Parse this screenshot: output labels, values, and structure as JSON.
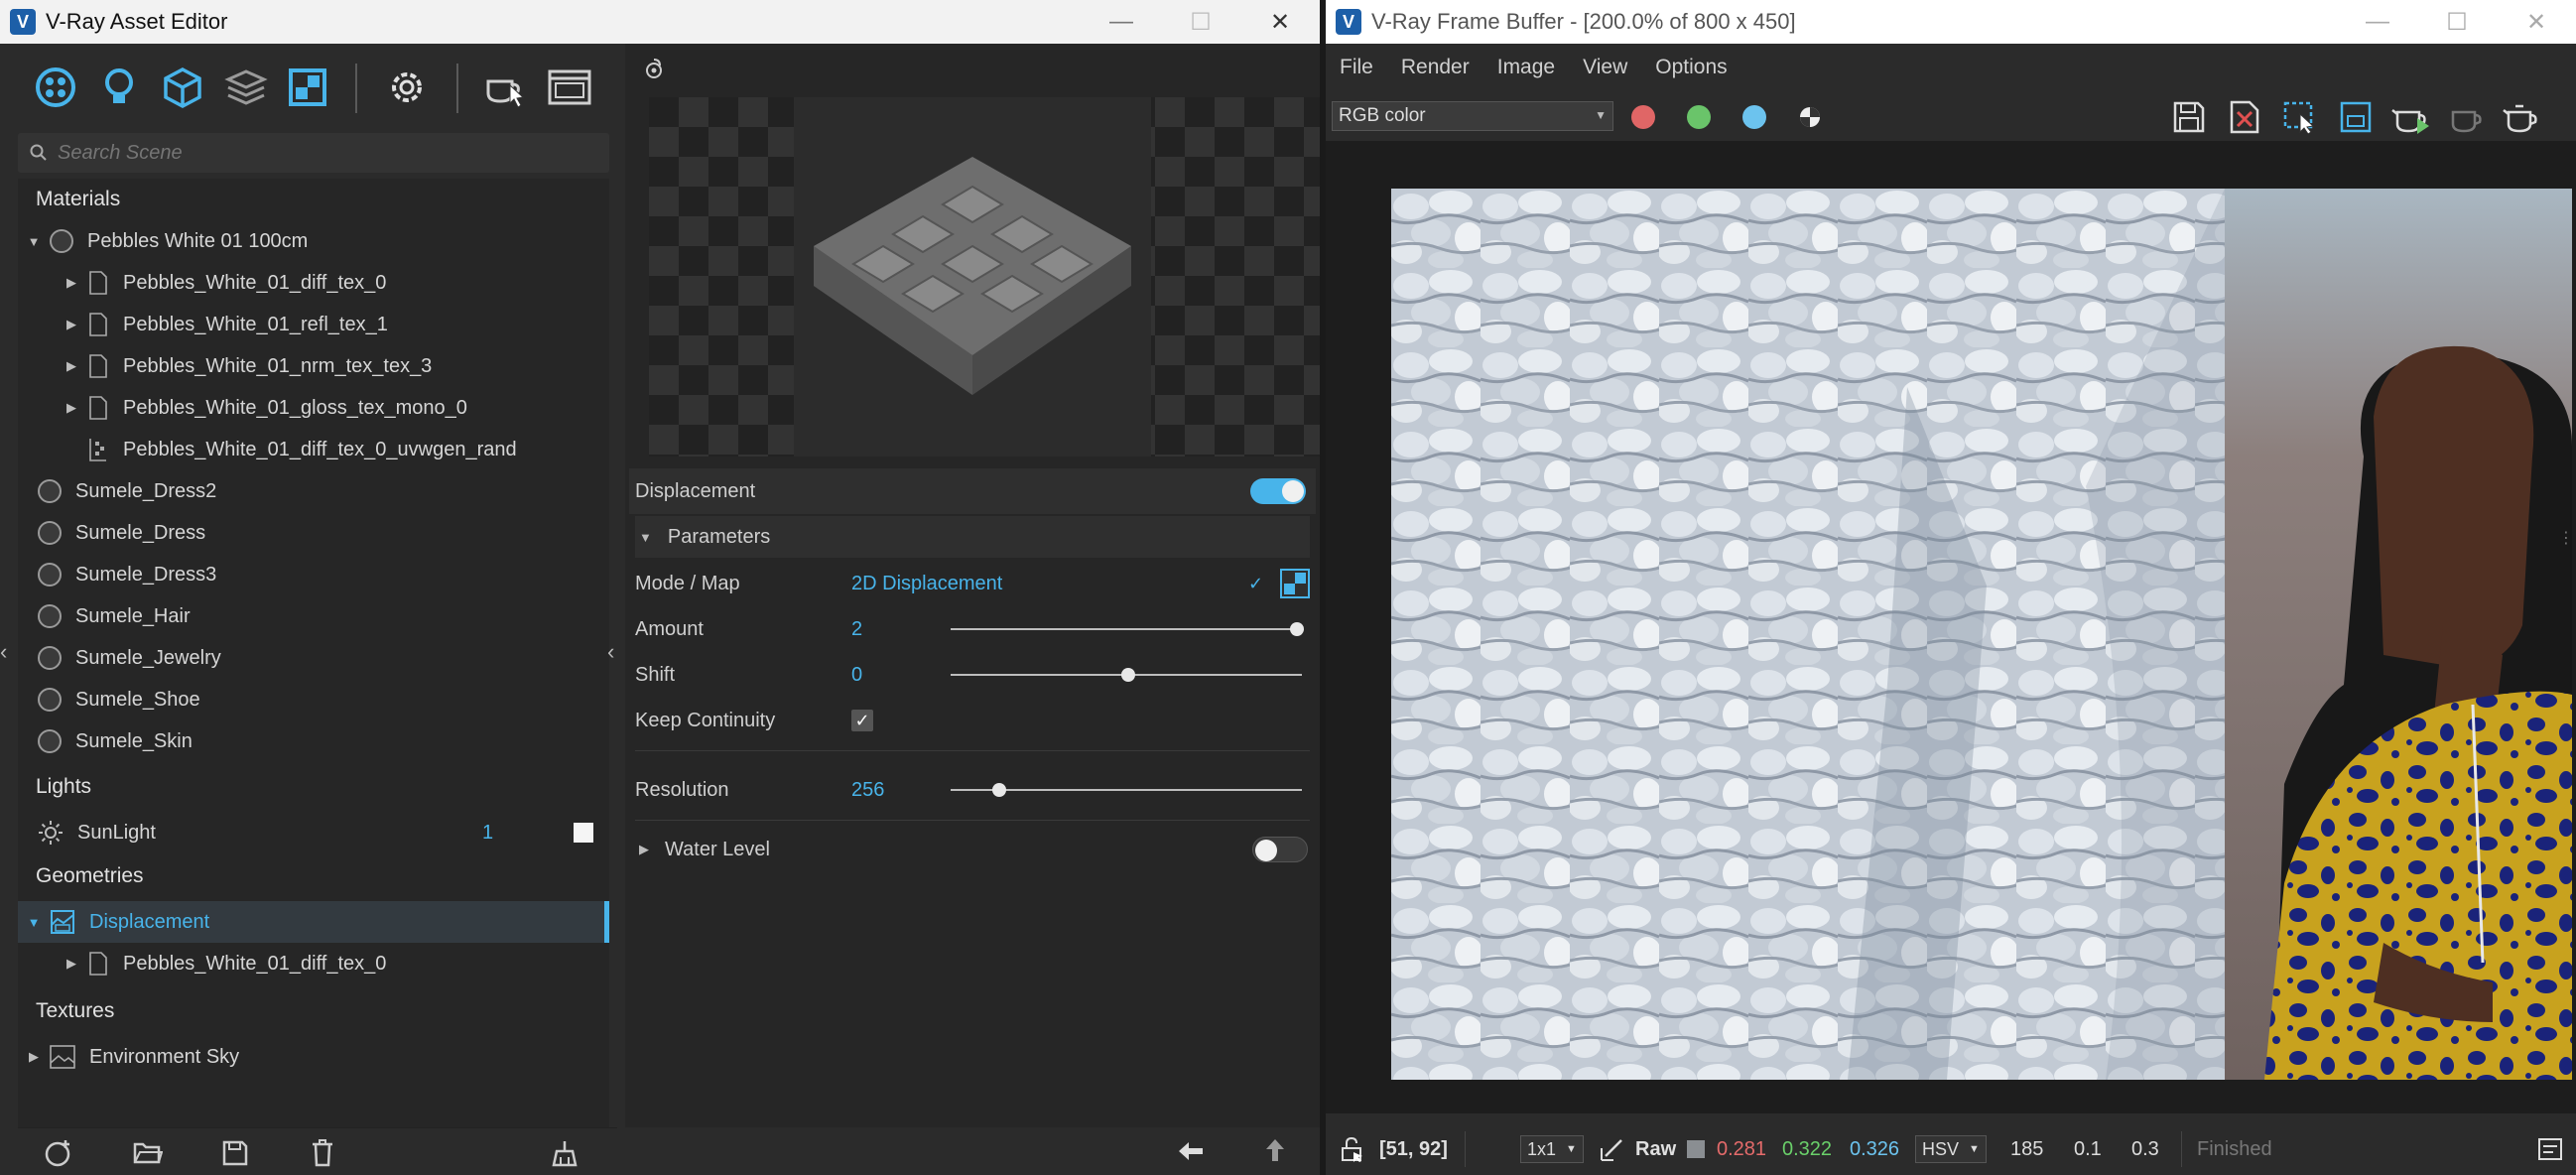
{
  "asset_editor": {
    "title": "V-Ray Asset Editor",
    "search_placeholder": "Search Scene",
    "sections": {
      "materials": "Materials",
      "lights": "Lights",
      "geometries": "Geometries",
      "textures": "Textures"
    },
    "material": {
      "name": "Pebbles White 01 100cm",
      "children": [
        "Pebbles_White_01_diff_tex_0",
        "Pebbles_White_01_refl_tex_1",
        "Pebbles_White_01_nrm_tex_tex_3",
        "Pebbles_White_01_gloss_tex_mono_0",
        "Pebbles_White_01_diff_tex_0_uvwgen_rand"
      ]
    },
    "materials_other": [
      "Sumele_Dress2",
      "Sumele_Dress",
      "Sumele_Dress3",
      "Sumele_Hair",
      "Sumele_Jewelry",
      "Sumele_Shoe",
      "Sumele_Skin"
    ],
    "light": {
      "name": "SunLight",
      "count": "1"
    },
    "geometry": {
      "name": "Displacement",
      "child": "Pebbles_White_01_diff_tex_0"
    },
    "texture": {
      "name": "Environment Sky"
    },
    "params": {
      "header": "Displacement",
      "group": "Parameters",
      "mode_label": "Mode / Map",
      "mode_value": "2D Displacement",
      "amount_label": "Amount",
      "amount_value": "2",
      "shift_label": "Shift",
      "shift_value": "0",
      "keep_label": "Keep Continuity",
      "resolution_label": "Resolution",
      "resolution_value": "256",
      "water_label": "Water Level"
    }
  },
  "frame_buffer": {
    "title": "V-Ray Frame Buffer - [200.0% of 800 x 450]",
    "menu": [
      "File",
      "Render",
      "Image",
      "View",
      "Options"
    ],
    "channel": "RGB color",
    "status": {
      "coords": "[51, 92]",
      "zoom": "1x1",
      "raw": "Raw",
      "r": "0.281",
      "g": "0.322",
      "b": "0.326",
      "mode": "HSV",
      "h": "185",
      "s": "0.1",
      "v": "0.3",
      "state": "Finished"
    }
  },
  "colors": {
    "accent": "#48b4ea",
    "red_channel": "#e06666",
    "green_channel": "#6ac46a",
    "blue_channel": "#6cc3ee"
  }
}
